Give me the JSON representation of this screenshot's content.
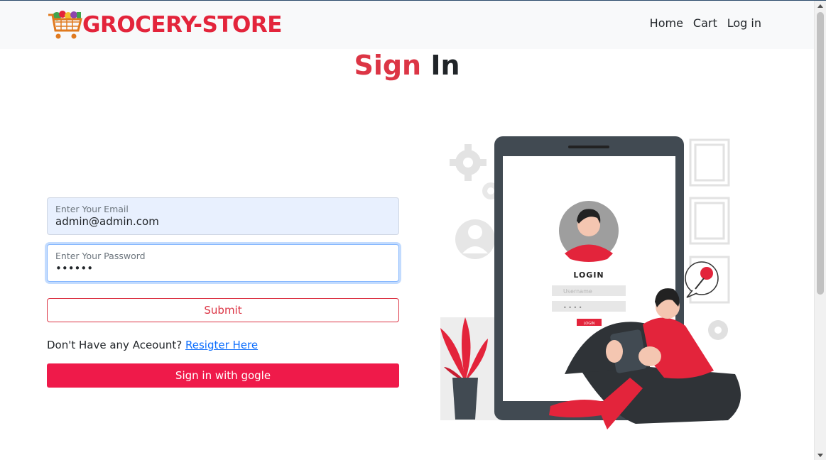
{
  "navbar": {
    "brand": "GROCERY-STORE",
    "links": [
      "Home",
      "Cart",
      "Log in"
    ]
  },
  "title": {
    "part1": "Sign",
    "part2": "In"
  },
  "form": {
    "email_label": "Enter Your Email",
    "email_value": "admin@admin.com",
    "password_label": "Enter Your Password",
    "password_value": "••••••",
    "submit_label": "Submit",
    "register_prompt": "Don't Have any Aceount?",
    "register_link": "Resigter Here",
    "google_label": "Sign in with gogle"
  },
  "illustration": {
    "login_heading": "LOGIN",
    "username_placeholder": "Username",
    "login_button": "LOGIN"
  },
  "colors": {
    "brand_red": "#dc3545",
    "google_red": "#ef1a4a",
    "link_blue": "#0d6efd"
  }
}
